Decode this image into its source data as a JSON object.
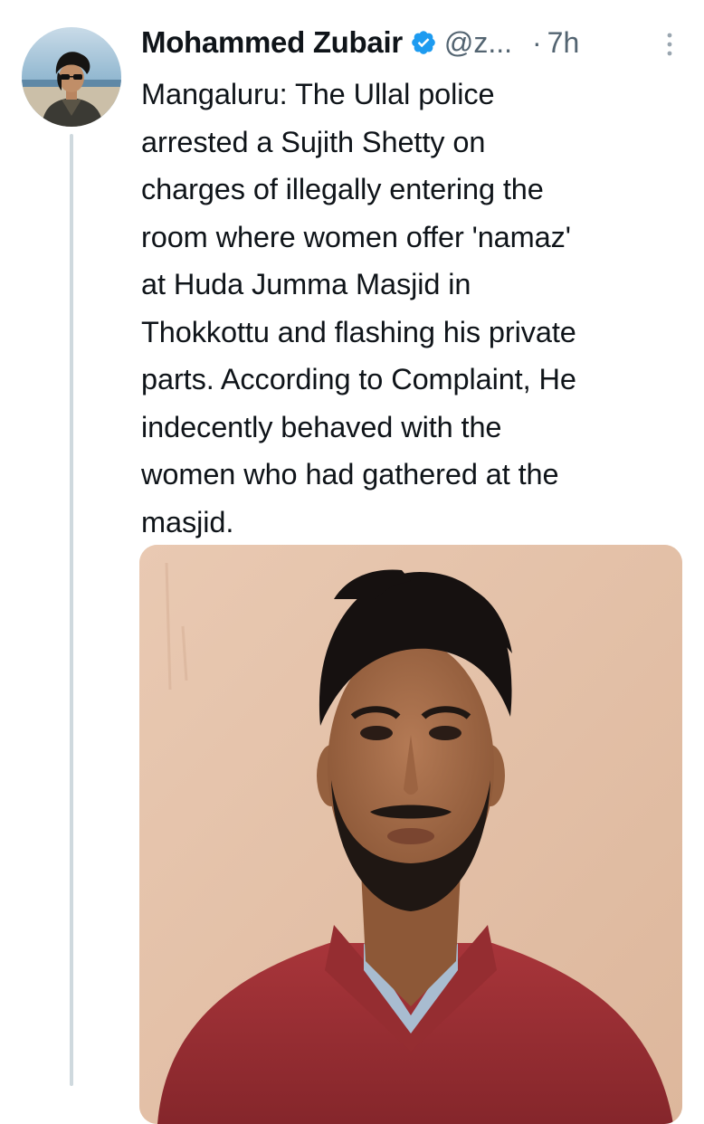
{
  "tweet": {
    "author_name": "Mohammed Zubair",
    "handle": "@z...",
    "separator": "·",
    "time": "7h",
    "verified_icon": "verified-badge-icon",
    "more_icon": "more-vertical-icon",
    "text_lines": [
      "Mangaluru: The Ullal police",
      "arrested a Sujith Shetty on",
      "charges of illegally entering the",
      "room where women offer 'namaz'",
      "at Huda Jumma Masjid in",
      "Thokkottu and flashing his private",
      "parts. According to Complaint, He",
      "indecently behaved with the",
      "women who had gathered at the",
      "masjid."
    ]
  },
  "colors": {
    "text_primary": "#0f1419",
    "text_secondary": "#536471",
    "verified_blue": "#1d9bf0",
    "thread_line": "#cfd9de",
    "photo_wall": "#e5c3aa",
    "shirt": "#9b2f33"
  }
}
